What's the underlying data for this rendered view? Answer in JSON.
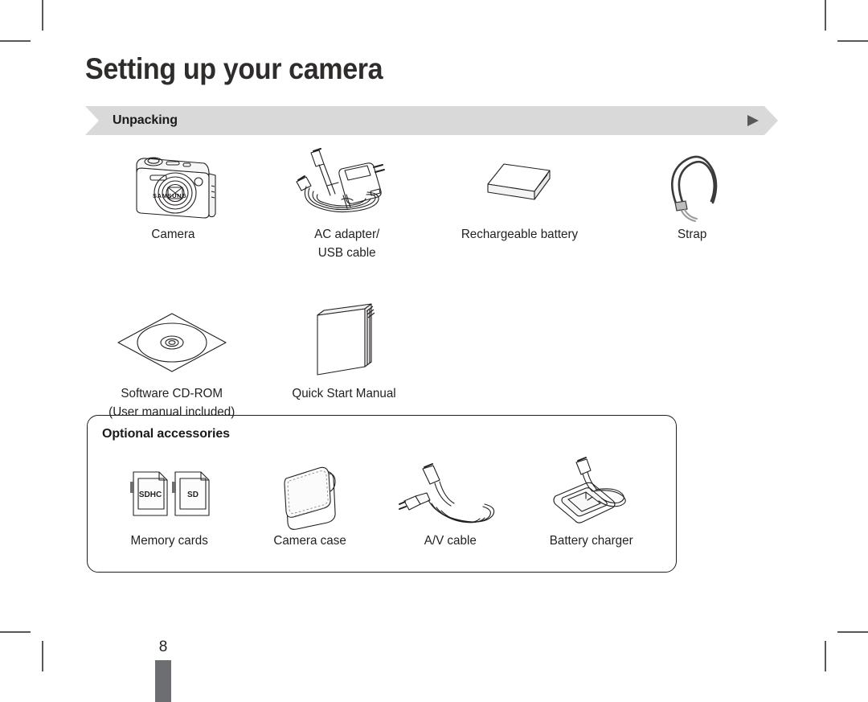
{
  "page": {
    "title": "Setting up your camera",
    "number": "8"
  },
  "section": {
    "label": "Unpacking",
    "arrow_icon": "triangle-right-icon",
    "banner_color": "#d9d9d9",
    "arrow_color": "#58585a"
  },
  "unpacking": {
    "items": [
      {
        "caption": "Camera",
        "icon": "camera-illustration",
        "brand_text": "SAMSUNG"
      },
      {
        "caption": "AC adapter/\nUSB cable",
        "icon": "ac-adapter-usb-cable-illustration"
      },
      {
        "caption": "Rechargeable battery",
        "icon": "battery-illustration"
      },
      {
        "caption": "Strap",
        "icon": "strap-illustration"
      },
      {
        "caption": "Software CD-ROM\n(User manual included)",
        "icon": "cd-rom-illustration"
      },
      {
        "caption": "Quick Start Manual",
        "icon": "manual-booklet-illustration"
      }
    ]
  },
  "optional": {
    "title": "Optional accessories",
    "items": [
      {
        "caption": "Memory cards",
        "icon": "memory-cards-illustration",
        "card_labels": [
          "SDHC",
          "SD"
        ]
      },
      {
        "caption": "Camera case",
        "icon": "camera-case-illustration"
      },
      {
        "caption": "A/V cable",
        "icon": "av-cable-illustration"
      },
      {
        "caption": "Battery charger",
        "icon": "battery-charger-illustration"
      }
    ]
  },
  "footer": {
    "bar_color": "#6d6e71"
  }
}
